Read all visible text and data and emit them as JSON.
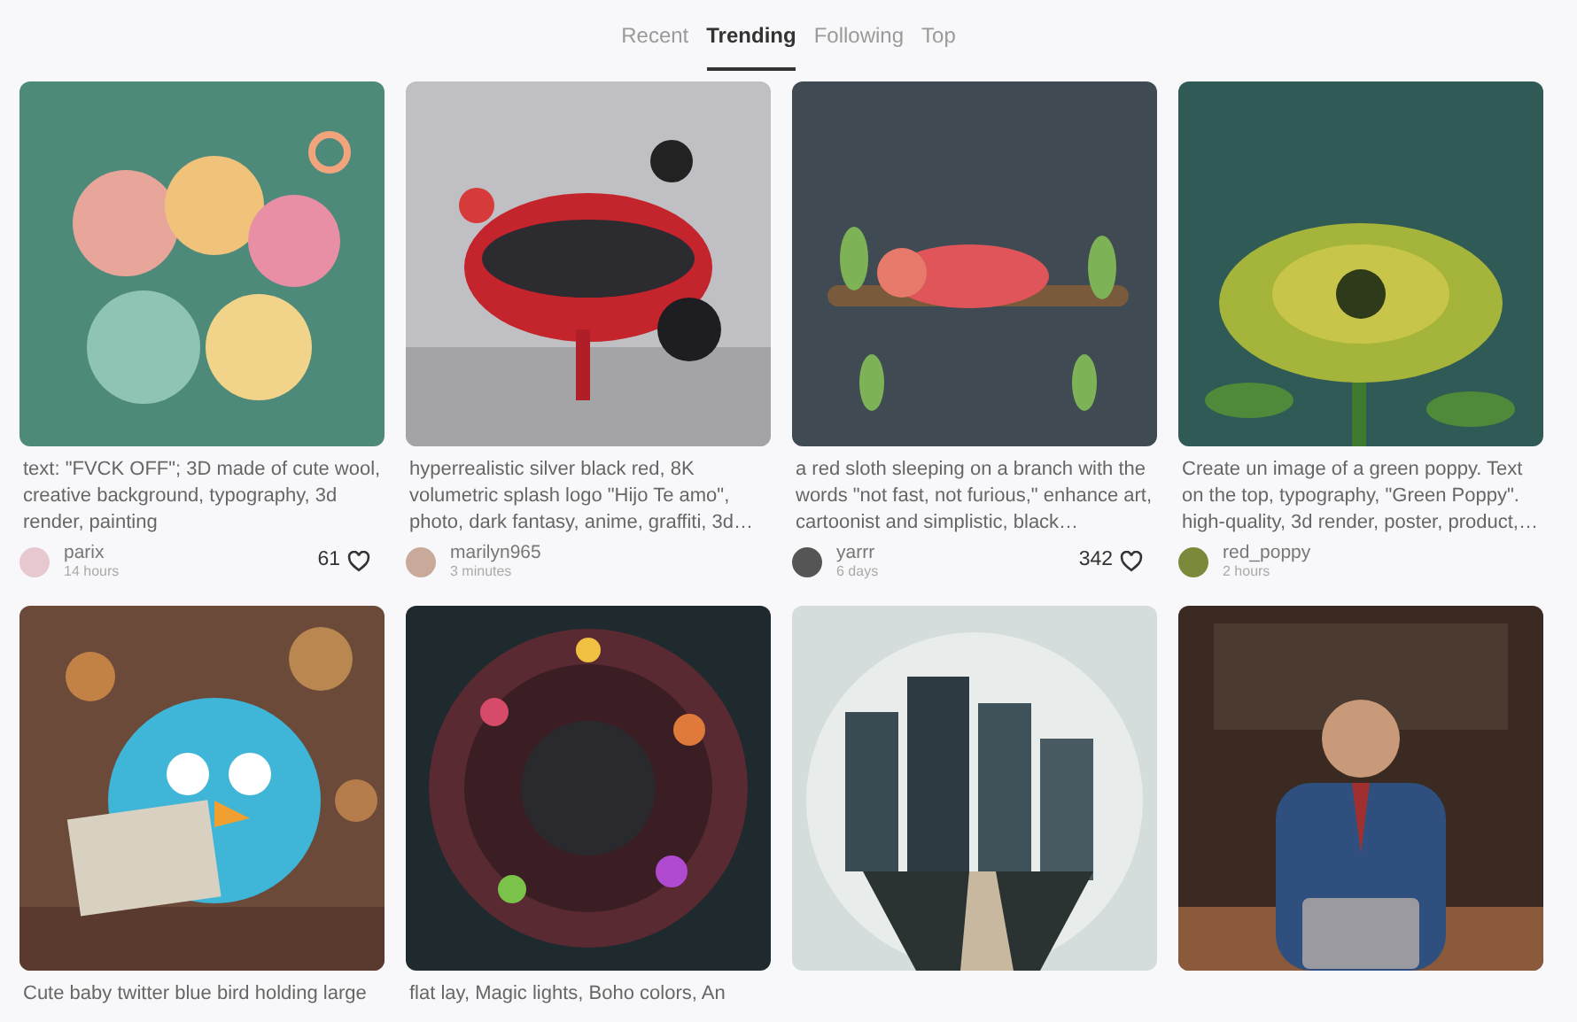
{
  "tabs": [
    {
      "label": "Recent",
      "selected": false
    },
    {
      "label": "Trending",
      "selected": true
    },
    {
      "label": "Following",
      "selected": false
    },
    {
      "label": "Top",
      "selected": false
    }
  ],
  "cards": [
    {
      "picture": {
        "kind": "picture"
      },
      "prompt": "text: \"FVCK OFF\"; 3D made of cute wool, creative background, typography, 3d render, painting",
      "author": "parix",
      "time": "14 hours",
      "likes": "61"
    },
    {
      "picture": {
        "kind": "picture"
      },
      "prompt": "hyperrealistic silver black red, 8K volumetric splash logo \"Hijo Te amo\", photo, dark fantasy, anime, graffiti, 3d…",
      "author": "marilyn965",
      "time": "3 minutes"
    },
    {
      "picture": {
        "kind": "picture"
      },
      "prompt": "a red sloth sleeping on a branch with the words \"not fast, not furious,\" enhance art, cartoonist and simplistic, black…",
      "author": "yarrr",
      "time": "6 days",
      "likes": "342"
    },
    {
      "picture": {
        "kind": "picture"
      },
      "prompt": "Create un image of a green poppy. Text on the top, typography, \"Green Poppy\". high-quality, 3d render, poster, product,…",
      "author": "red_poppy",
      "time": "2 hours"
    },
    {
      "picture": {
        "kind": "picture"
      },
      "prompt": "Cute baby twitter blue bird holding large"
    },
    {
      "picture": {
        "kind": "picture"
      },
      "prompt": "flat lay, Magic lights, Boho colors, An"
    },
    {
      "picture": {
        "kind": "picture"
      }
    },
    {
      "picture": {
        "kind": "picture"
      }
    }
  ]
}
